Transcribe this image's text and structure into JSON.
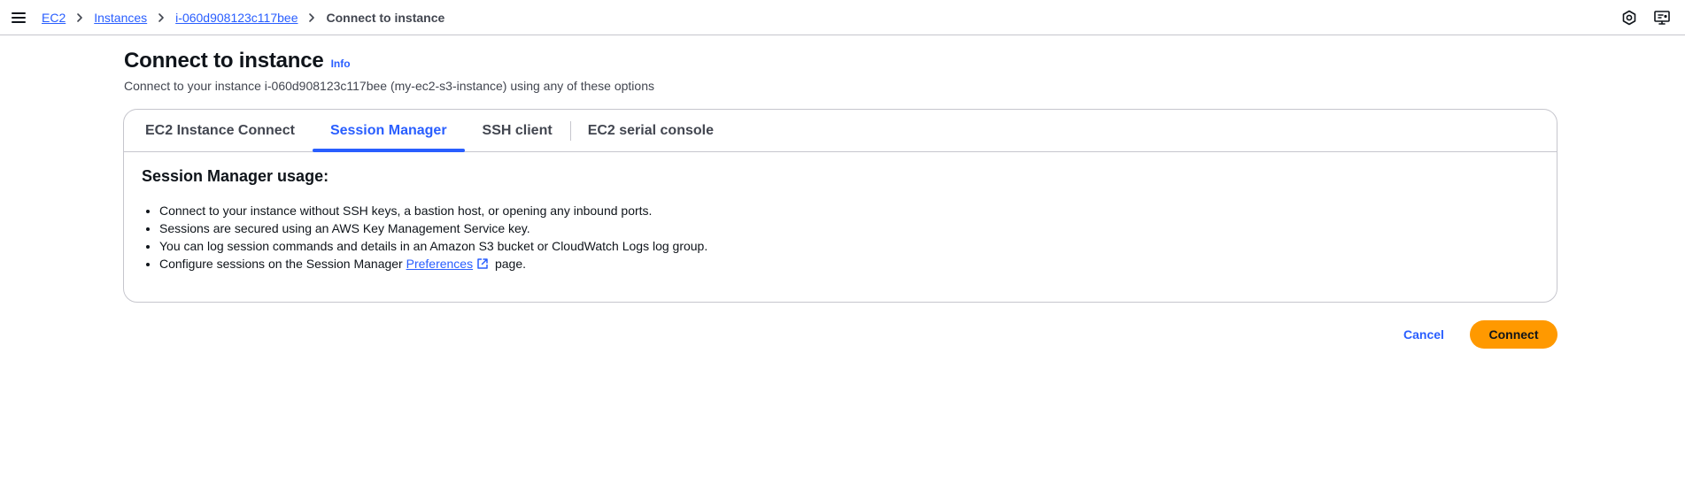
{
  "breadcrumb": {
    "items": [
      "EC2",
      "Instances",
      "i-060d908123c117bee"
    ],
    "current": "Connect to instance"
  },
  "header": {
    "title": "Connect to instance",
    "info_label": "Info",
    "description": "Connect to your instance i-060d908123c117bee (my-ec2-s3-instance) using any of these options"
  },
  "tabs": [
    {
      "label": "EC2 Instance Connect",
      "active": false
    },
    {
      "label": "Session Manager",
      "active": true
    },
    {
      "label": "SSH client",
      "active": false
    },
    {
      "label": "EC2 serial console",
      "active": false
    }
  ],
  "session_manager": {
    "heading": "Session Manager usage:",
    "bullets": [
      "Connect to your instance without SSH keys, a bastion host, or opening any inbound ports.",
      "Sessions are secured using an AWS Key Management Service key.",
      "You can log session commands and details in an Amazon S3 bucket or CloudWatch Logs log group."
    ],
    "config_prefix": "Configure sessions on the Session Manager ",
    "config_link": "Preferences",
    "config_suffix": " page."
  },
  "actions": {
    "cancel_label": "Cancel",
    "connect_label": "Connect"
  },
  "icons": {
    "menu": "hamburger-menu-icon",
    "chevron": "chevron-right-icon",
    "top_right_1": "notifications-icon",
    "top_right_2": "display-settings-icon",
    "external": "external-link-icon"
  },
  "colors": {
    "link": "#295eff",
    "primary_button": "#ff9900",
    "border": "#c6c6cd",
    "text": "#0f141a"
  }
}
